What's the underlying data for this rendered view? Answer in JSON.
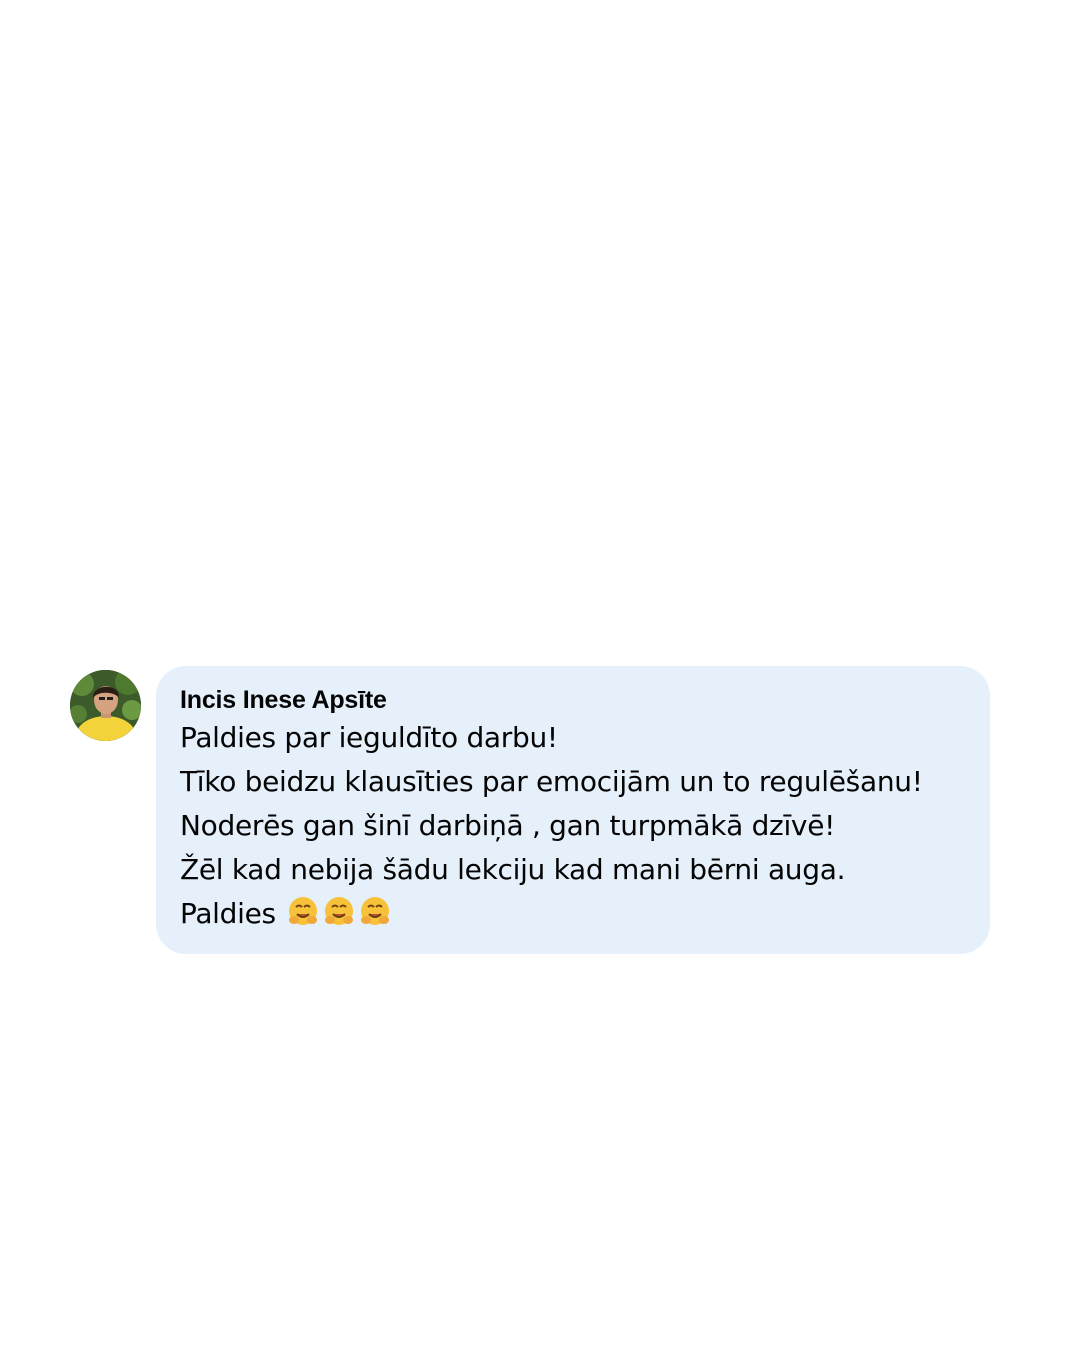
{
  "comment": {
    "author": "Incis Inese Apsīte",
    "lines": [
      "Paldies par ieguldīto darbu!",
      "Tīko beidzu klausīties par emocijām un to regulēšanu!",
      "Noderēs gan šinī darbiņā , gan turpmākā dzīvē!",
      "Žēl kad nebija šādu lekciju kad mani bērni auga.",
      "Paldies"
    ],
    "emoji": [
      "hugging-face-emoji",
      "hugging-face-emoji",
      "hugging-face-emoji"
    ],
    "avatar_icon": "profile-photo-avatar"
  },
  "colors": {
    "bubble": "#e6f0fb",
    "text": "#050505",
    "emoji": "#f7c23a"
  }
}
